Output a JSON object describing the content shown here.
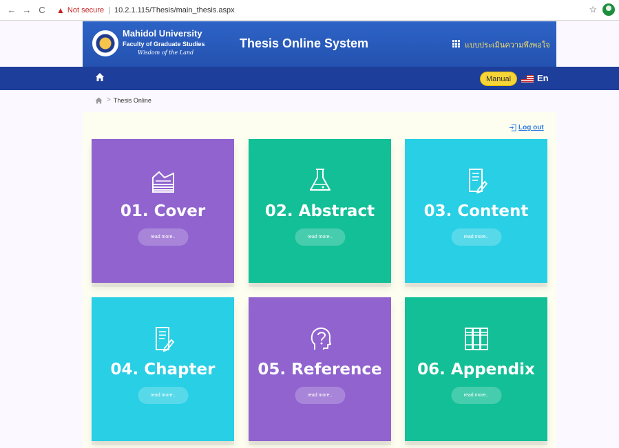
{
  "browser": {
    "back": "←",
    "forward": "→",
    "reload": "C",
    "warning_icon": "▲",
    "not_secure": "Not secure",
    "separator": "|",
    "url": "10.2.1.115/Thesis/main_thesis.aspx",
    "star": "☆"
  },
  "header": {
    "university": "Mahidol University",
    "faculty": "Faculty of Graduate Studies",
    "motto": "Wisdom of the Land",
    "system_title": "Thesis Online System",
    "survey_link": "แบบประเมินความพึงพอใจ"
  },
  "navbar": {
    "manual_label": "Manual",
    "language_label": "En"
  },
  "breadcrumb": {
    "separator": ">",
    "current": "Thesis Online"
  },
  "logout_label": "Log out",
  "cards": [
    {
      "title": "01. Cover",
      "button": "read more..",
      "color": "#9163cf",
      "icon": "papers-stack-icon"
    },
    {
      "title": "02. Abstract",
      "button": "read more..",
      "color": "#13bf96",
      "icon": "flask-icon"
    },
    {
      "title": "03. Content",
      "button": "read more..",
      "color": "#28cfe5",
      "icon": "document-pen-icon"
    },
    {
      "title": "04. Chapter",
      "button": "read more..",
      "color": "#28cfe5",
      "icon": "document-pen-icon"
    },
    {
      "title": "05. Reference",
      "button": "read more..",
      "color": "#9163cf",
      "icon": "question-head-icon"
    },
    {
      "title": "06. Appendix",
      "button": "read more..",
      "color": "#13bf96",
      "icon": "books-icon"
    }
  ]
}
